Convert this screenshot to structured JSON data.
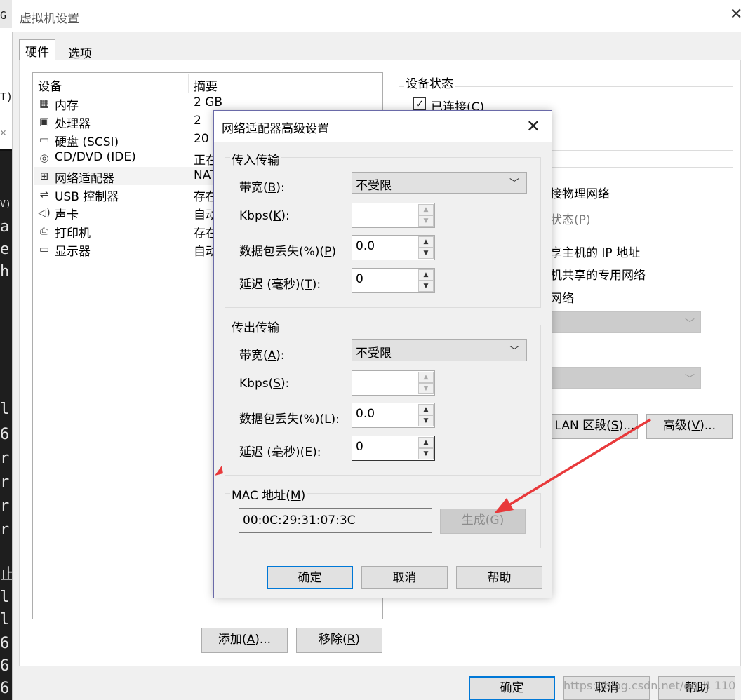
{
  "bg_window": {
    "strip_top_chars": [
      "G",
      "T)",
      "×",
      "V)"
    ],
    "strip_chars": [
      "a",
      "e",
      "h",
      "l",
      "6",
      "r",
      "r",
      "r",
      "r",
      "止",
      "l",
      "l",
      "6",
      "6",
      "6"
    ]
  },
  "window": {
    "title": "虚拟机设置",
    "close_glyph": "✕"
  },
  "tabs": [
    {
      "label": "硬件"
    },
    {
      "label": "选项"
    }
  ],
  "devices": {
    "header_device": "设备",
    "header_summary": "摘要",
    "rows": [
      {
        "name": "内存",
        "summary": "2 GB",
        "icon": "memory-icon",
        "glyph": "▦"
      },
      {
        "name": "处理器",
        "summary": "2",
        "icon": "cpu-icon",
        "glyph": "▣"
      },
      {
        "name": "硬盘 (SCSI)",
        "summary": "20 (",
        "icon": "disk-icon",
        "glyph": "▭"
      },
      {
        "name": "CD/DVD (IDE)",
        "summary": "正在",
        "icon": "cd-icon",
        "glyph": "◎"
      },
      {
        "name": "网络适配器",
        "summary": "NAT",
        "icon": "network-icon",
        "glyph": "⊞"
      },
      {
        "name": "USB 控制器",
        "summary": "存在",
        "icon": "usb-icon",
        "glyph": "⇌"
      },
      {
        "name": "声卡",
        "summary": "自动",
        "icon": "speaker-icon",
        "glyph": "◁)"
      },
      {
        "name": "打印机",
        "summary": "存在",
        "icon": "printer-icon",
        "glyph": "⎙"
      },
      {
        "name": "显示器",
        "summary": "自动",
        "icon": "monitor-icon",
        "glyph": "▭"
      }
    ],
    "add_label_pre": "添加(",
    "add_key": "A",
    "add_label_post": ")...",
    "remove_label_pre": "移除(",
    "remove_key": "R",
    "remove_label_post": ")"
  },
  "right_panel": {
    "device_status_title": "设备状态",
    "connected_pre": "已连接(",
    "connected_key": "C",
    "connected_post": ")",
    "connected_checked": true,
    "bridged_text": "接物理网络",
    "replicate_text": "状态(P)",
    "nat_text": "享主机的 IP 地址",
    "hostonly_text": "机共享的专用网络",
    "custom_text": "网络",
    "lan_segment_pre": "LAN 区段(",
    "lan_segment_key": "S",
    "lan_segment_post": ")...",
    "advanced_pre": "高级(",
    "advanced_key": "V",
    "advanced_post": ")..."
  },
  "footer": {
    "ok_label": "确定",
    "cancel_label": "取消",
    "help_label": "帮助"
  },
  "dialog": {
    "title": "网络适配器高级设置",
    "close_glyph": "✕",
    "incoming": {
      "title": "传入传输",
      "bandwidth_label_pre": "带宽(",
      "bandwidth_key": "B",
      "bandwidth_label_post": "):",
      "bandwidth_value": "不受限",
      "kbps_label_pre": "Kbps(",
      "kbps_key": "K",
      "kbps_label_post": "):",
      "kbps_value": "",
      "loss_label_pre": "数据包丢失(%)(",
      "loss_key": "P",
      "loss_label_post": ")",
      "loss_value": "0.0",
      "latency_label_pre": "延迟 (毫秒)(",
      "latency_key": "T",
      "latency_label_post": "):",
      "latency_value": "0"
    },
    "outgoing": {
      "title": "传出传输",
      "bandwidth_label_pre": "带宽(",
      "bandwidth_key": "A",
      "bandwidth_label_post": "):",
      "bandwidth_value": "不受限",
      "kbps_label_pre": "Kbps(",
      "kbps_key": "S",
      "kbps_label_post": "):",
      "kbps_value": "",
      "loss_label_pre": "数据包丢失(%)(",
      "loss_key": "L",
      "loss_label_post": "):",
      "loss_value": "0.0",
      "latency_label_pre": "延迟 (毫秒)(",
      "latency_key": "E",
      "latency_label_post": "):",
      "latency_value": "0"
    },
    "mac": {
      "title_pre": "MAC 地址(",
      "title_key": "M",
      "title_post": ")",
      "value": "00:0C:29:31:07:3C",
      "generate_pre": "生成(",
      "generate_key": "G",
      "generate_post": ")"
    },
    "ok_label": "确定",
    "cancel_label": "取消",
    "help_label": "帮助"
  },
  "annotation": {
    "arrow_color": "#e8393b"
  },
  "watermark": "https://blog.csdn.net/qq_4   110"
}
